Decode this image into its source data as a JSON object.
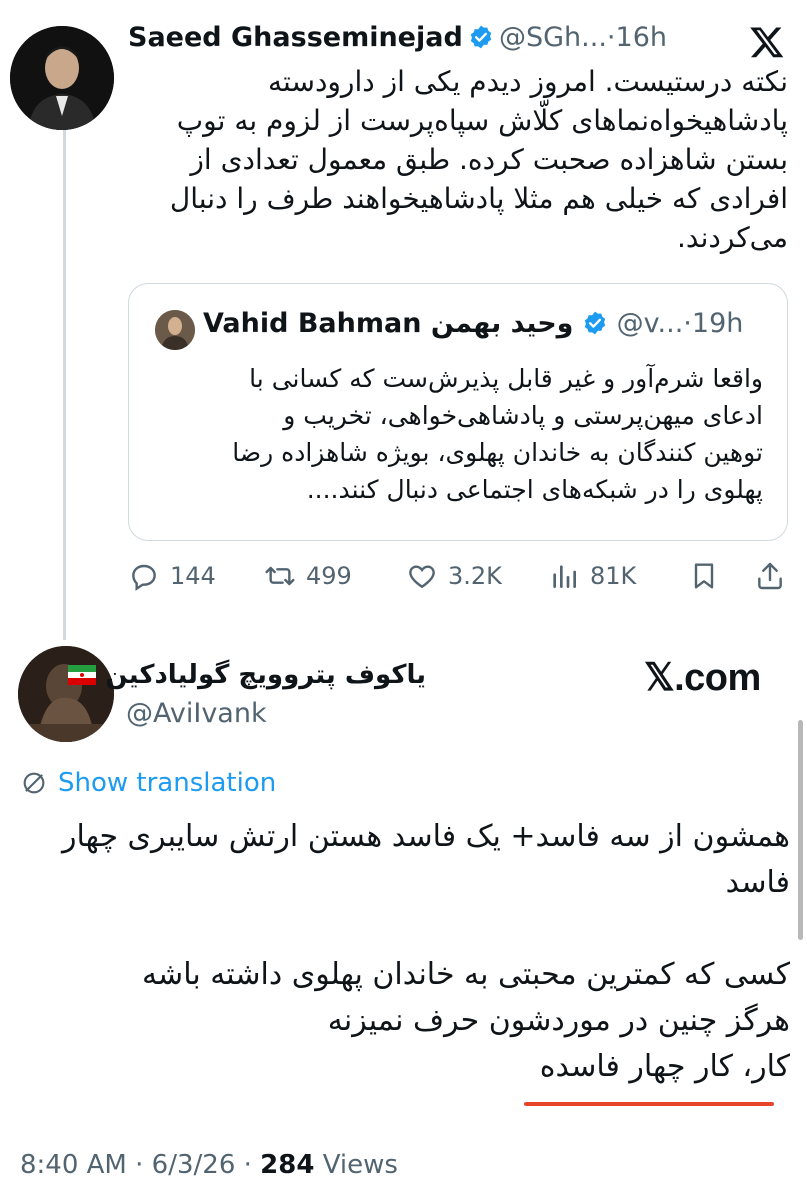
{
  "tweet": {
    "display_name": "Saeed Ghasseminejad",
    "handle": "@SGh...",
    "sep": "·",
    "time": "16h",
    "lines": [
      "نکته درستیست. امروز دیدم یکی از دارودسته",
      "پادشاهیخواه‌نماهای کلّاش سپاه‌پرست از لزوم به توپ",
      "بستن شاهزاده صحبت کرده. طبق معمول تعدادی از",
      "افرادی که خیلی هم مثلا پادشاهیخواهند طرف را دنبال",
      "می‌کردند."
    ],
    "quote": {
      "display_name": "Vahid Bahman وحید بهمن",
      "handle": "@v...",
      "sep": "·",
      "time": "19h",
      "lines": [
        "واقعا شرم‌آور و غیر قابل پذیرش‌ست که کسانی با",
        "ادعای میهن‌پرستی و پادشاهی‌خواهی، تخریب و",
        "توهین کنندگان به خاندان پهلوی، بویژه شاهزاده رضا",
        "پهلوی را در شبکه‌های اجتماعی دنبال کنند...."
      ]
    },
    "stats": {
      "replies": "144",
      "retweets": "499",
      "likes": "3.2K",
      "views": "81K"
    }
  },
  "reply": {
    "display_name": "یاکوف پتروویچ گولیادکین",
    "handle": "@AviIvank",
    "brand": "𝕏.com",
    "show_translation": "Show translation",
    "paragraph1": [
      "همشون از سه فاسد+ یک فاسد هستن ارتش سایبری چهار",
      "فاسد"
    ],
    "paragraph2": [
      "کسی که کمترین محبتی به خاندان پهلوی داشته باشه",
      "هرگز چنین در موردشون حرف نمیزنه",
      "کار، کار چهار فاسده"
    ],
    "footer": {
      "time": "8:40 AM",
      "date": "6/3/26",
      "views_count": "284",
      "views_label": "Views"
    }
  },
  "colors": {
    "verified": "#1d9bf0",
    "link": "#1d9bf0",
    "underline": "#e8452a",
    "secondary": "#536471"
  }
}
